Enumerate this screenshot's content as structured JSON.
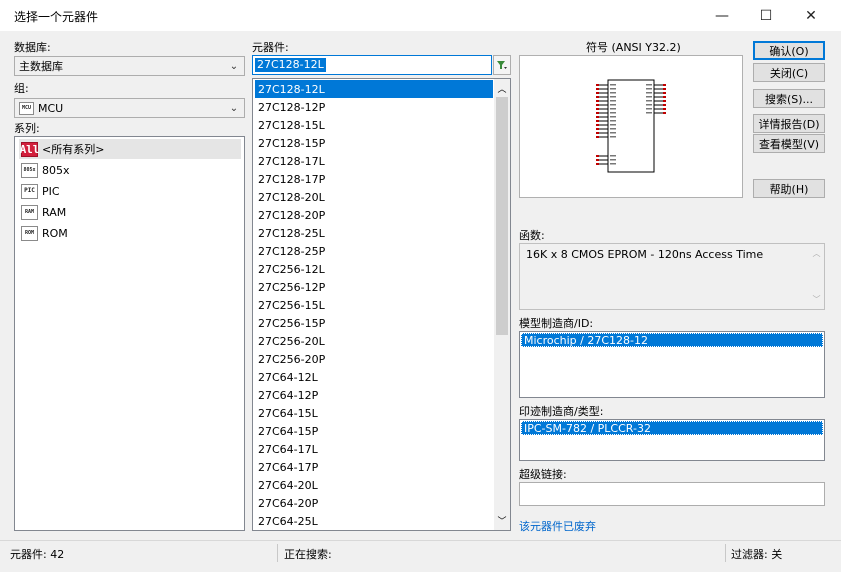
{
  "window": {
    "title": "选择一个元器件",
    "minimize_glyph": "—",
    "maximize_glyph": "☐",
    "close_glyph": "✕"
  },
  "database": {
    "label": "数据库:",
    "value": "主数据库"
  },
  "group": {
    "label": "组:",
    "value": "MCU",
    "icon": "mcu-chip-icon",
    "icon_text": "MCU"
  },
  "family": {
    "label": "系列:",
    "items": [
      {
        "label": "<所有系列>",
        "icon_text": "All",
        "icon": "all-families-icon"
      },
      {
        "label": "805x",
        "icon_text": "805x",
        "icon": "805x-chip-icon"
      },
      {
        "label": "PIC",
        "icon_text": "PIC",
        "icon": "pic-chip-icon"
      },
      {
        "label": "RAM",
        "icon_text": "RAM",
        "icon": "ram-chip-icon"
      },
      {
        "label": "ROM",
        "icon_text": "ROM",
        "icon": "rom-chip-icon"
      }
    ]
  },
  "component": {
    "label": "元器件:",
    "search_value": "27C128-12L",
    "filter_icon": "filter-icon",
    "items": [
      "27C128-12L",
      "27C128-12P",
      "27C128-15L",
      "27C128-15P",
      "27C128-17L",
      "27C128-17P",
      "27C128-20L",
      "27C128-20P",
      "27C128-25L",
      "27C128-25P",
      "27C256-12L",
      "27C256-12P",
      "27C256-15L",
      "27C256-15P",
      "27C256-20L",
      "27C256-20P",
      "27C64-12L",
      "27C64-12P",
      "27C64-15L",
      "27C64-15P",
      "27C64-17L",
      "27C64-17P",
      "27C64-20L",
      "27C64-20P",
      "27C64-25L"
    ],
    "selected_index": 0
  },
  "symbol": {
    "label": "符号 (ANSI Y32.2)"
  },
  "buttons": {
    "ok": "确认(O)",
    "close": "关闭(C)",
    "search": "搜索(S)...",
    "detail_report": "详情报告(D)",
    "view_model": "查看模型(V)",
    "help": "帮助(H)"
  },
  "function": {
    "label": "函数:",
    "value": "16K x 8 CMOS EPROM - 120ns Access Time"
  },
  "model_manufacturer": {
    "label": "模型制造商/ID:",
    "selected": "Microchip / 27C128-12"
  },
  "footprint_manufacturer": {
    "label": "印迹制造商/类型:",
    "selected": "IPC-SM-782 / PLCCR-32"
  },
  "hyperlink": {
    "label": "超级链接:",
    "value": ""
  },
  "obsolete_notice": "该元器件已废弃",
  "status": {
    "component_count": "元器件: 42",
    "searching": "正在搜索:",
    "filter": "过滤器: 关"
  },
  "colors": {
    "selection": "#0078d7",
    "link": "#0066cc",
    "all_icon": "#d21f3c"
  }
}
